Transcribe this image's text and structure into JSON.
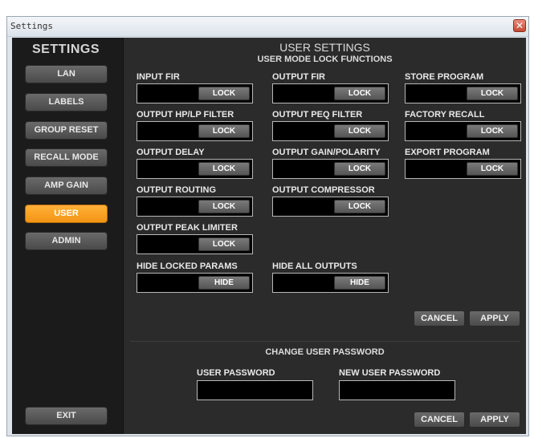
{
  "window": {
    "title": "Settings",
    "close_glyph": "✕"
  },
  "sidebar": {
    "title": "SETTINGS",
    "items": [
      {
        "label": "LAN"
      },
      {
        "label": "LABELS"
      },
      {
        "label": "GROUP RESET"
      },
      {
        "label": "RECALL MODE"
      },
      {
        "label": "AMP GAIN"
      },
      {
        "label": "USER",
        "active": true
      },
      {
        "label": "ADMIN"
      }
    ],
    "exit_label": "EXIT"
  },
  "main": {
    "title": "USER SETTINGS",
    "subtitle": "USER MODE LOCK FUNCTIONS",
    "locks": [
      {
        "label": "INPUT FIR",
        "button": "LOCK"
      },
      {
        "label": "OUTPUT FIR",
        "button": "LOCK"
      },
      {
        "label": "STORE PROGRAM",
        "button": "LOCK"
      },
      {
        "label": "OUTPUT HP/LP FILTER",
        "button": "LOCK"
      },
      {
        "label": "OUTPUT PEQ FILTER",
        "button": "LOCK"
      },
      {
        "label": "FACTORY RECALL",
        "button": "LOCK"
      },
      {
        "label": "OUTPUT DELAY",
        "button": "LOCK"
      },
      {
        "label": "OUTPUT GAIN/POLARITY",
        "button": "LOCK"
      },
      {
        "label": "EXPORT PROGRAM",
        "button": "LOCK"
      },
      {
        "label": "OUTPUT ROUTING",
        "button": "LOCK"
      },
      {
        "label": "OUTPUT COMPRESSOR",
        "button": "LOCK"
      },
      {
        "label": "OUTPUT PEAK LIMITER",
        "button": "LOCK"
      },
      {
        "label": "HIDE LOCKED PARAMS",
        "button": "HIDE"
      },
      {
        "label": "HIDE ALL OUTPUTS",
        "button": "HIDE"
      }
    ],
    "cancel_label": "CANCEL",
    "apply_label": "APPLY"
  },
  "password": {
    "title": "CHANGE USER PASSWORD",
    "user_label": "USER PASSWORD",
    "user_value": "",
    "new_label": "NEW USER PASSWORD",
    "new_value": "",
    "cancel_label": "CANCEL",
    "apply_label": "APPLY"
  },
  "colors": {
    "active_accent": "#f7a01e",
    "background": "#1b1b1b",
    "panel": "#2b2b2b"
  }
}
